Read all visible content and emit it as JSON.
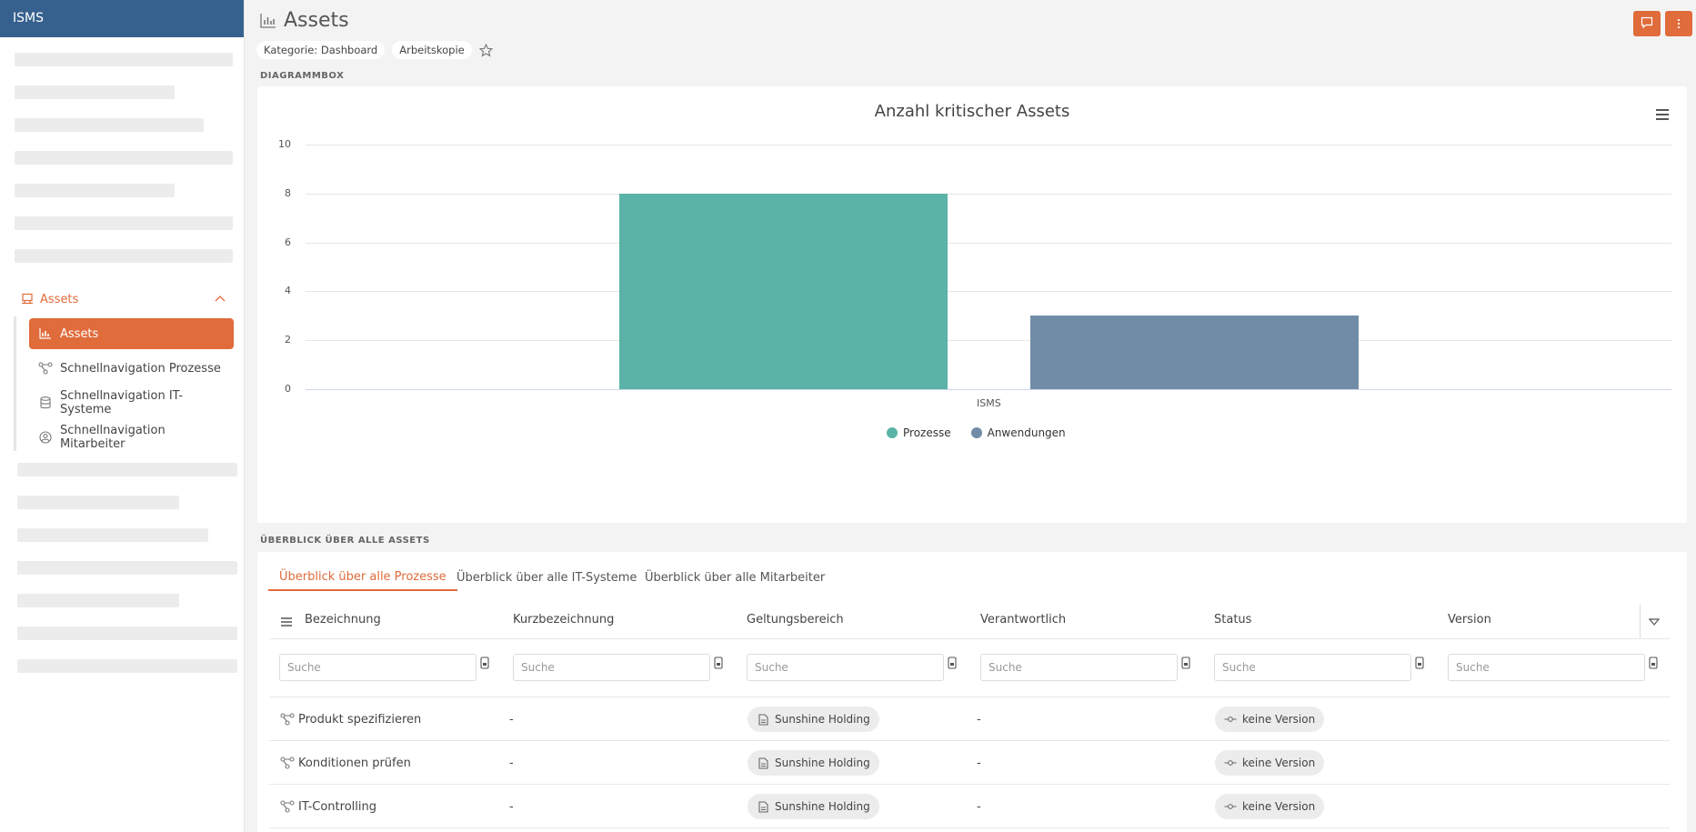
{
  "sidebar": {
    "title": "ISMS",
    "group_label": "Assets",
    "items": [
      {
        "label": "Assets",
        "active": true
      },
      {
        "label": "Schnellnavigation Prozesse"
      },
      {
        "label": "Schnellnavigation IT-Systeme"
      },
      {
        "label": "Schnellnavigation Mitarbeiter"
      }
    ]
  },
  "header": {
    "title": "Assets",
    "chips": [
      "Kategorie: Dashboard",
      "Arbeitskopie"
    ]
  },
  "sections": {
    "chart": "DIAGRAMMBOX",
    "overview": "ÜBERBLICK ÜBER ALLE ASSETS"
  },
  "chart_data": {
    "type": "bar",
    "title": "Anzahl kritischer Assets",
    "categories": [
      "ISMS"
    ],
    "series": [
      {
        "name": "Prozesse",
        "values": [
          8
        ],
        "color": "#5ab3a6"
      },
      {
        "name": "Anwendungen",
        "values": [
          3
        ],
        "color": "#718ca6"
      }
    ],
    "ylim": [
      0,
      10
    ],
    "yticks": [
      "0",
      "2",
      "4",
      "6",
      "8",
      "10"
    ],
    "grid": true,
    "legend": "bottom-center"
  },
  "tabs": [
    "Überblick über alle Prozesse",
    "Überblick über alle IT-Systeme",
    "Überblick über alle Mitarbeiter"
  ],
  "table": {
    "columns": [
      "Bezeichnung",
      "Kurzbezeichnung",
      "Geltungsbereich",
      "Verantwortlich",
      "Status",
      "Version"
    ],
    "search_placeholder": "Suche",
    "rows": [
      {
        "name": "Produkt spezifizieren",
        "short": "-",
        "scope": "Sunshine Holding",
        "owner": "-",
        "status": "keine Version"
      },
      {
        "name": "Konditionen prüfen",
        "short": "-",
        "scope": "Sunshine Holding",
        "owner": "-",
        "status": "keine Version"
      },
      {
        "name": "IT-Controlling",
        "short": "-",
        "scope": "Sunshine Holding",
        "owner": "-",
        "status": "keine Version"
      }
    ]
  },
  "colors": {
    "accent": "#e06b3b",
    "brand": "#36618e"
  }
}
